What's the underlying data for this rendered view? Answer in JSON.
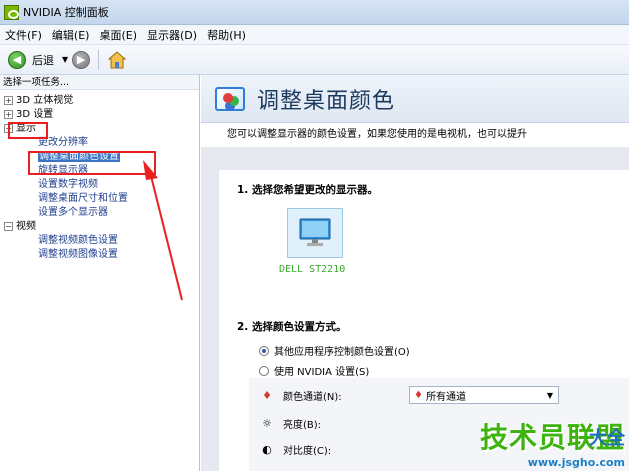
{
  "window": {
    "title": "NVIDIA 控制面板"
  },
  "menu": [
    "文件(F)",
    "编辑(E)",
    "桌面(E)",
    "显示器(D)",
    "帮助(H)"
  ],
  "toolbar": {
    "back_label": "后退"
  },
  "left_panel": {
    "header": "选择一项任务...",
    "tree": [
      {
        "toggle": "⊞",
        "label": "3D 立体视觉"
      },
      {
        "toggle": "⊞",
        "label": "3D 设置"
      },
      {
        "toggle": "⊟",
        "label": "显示"
      },
      {
        "label": "更改分辨率"
      },
      {
        "label": "调整桌面颜色设置",
        "selected": true
      },
      {
        "label": "旋转显示器"
      },
      {
        "label": "设置数字视频"
      },
      {
        "label": "调整桌面尺寸和位置"
      },
      {
        "label": "设置多个显示器"
      },
      {
        "toggle": "⊟",
        "label": "视频"
      },
      {
        "label": "调整视频颜色设置"
      },
      {
        "label": "调整视频图像设置"
      }
    ]
  },
  "page": {
    "title": "调整桌面颜色",
    "description": "您可以调整显示器的颜色设置，如果您使用的是电视机，也可以提升"
  },
  "section1": {
    "title": "1. 选择您希望更改的显示器。",
    "monitor_name": "DELL ST2210"
  },
  "section2": {
    "title": "2. 选择颜色设置方式。",
    "option1": "其他应用程序控制颜色设置(O)",
    "option2": "使用 NVIDIA 设置(S)",
    "channel_label": "颜色通道(N):",
    "channel_value": "所有通道",
    "brightness_label": "亮度(B):",
    "contrast_label": "对比度(C):"
  },
  "watermark": {
    "main": "技术员联盟",
    "side": "大全",
    "url": "www.jsgho.com"
  },
  "colors": {
    "accent": "#3b74c5",
    "annotation_red": "#ea1f1f",
    "nvidia_green": "#76b900"
  }
}
